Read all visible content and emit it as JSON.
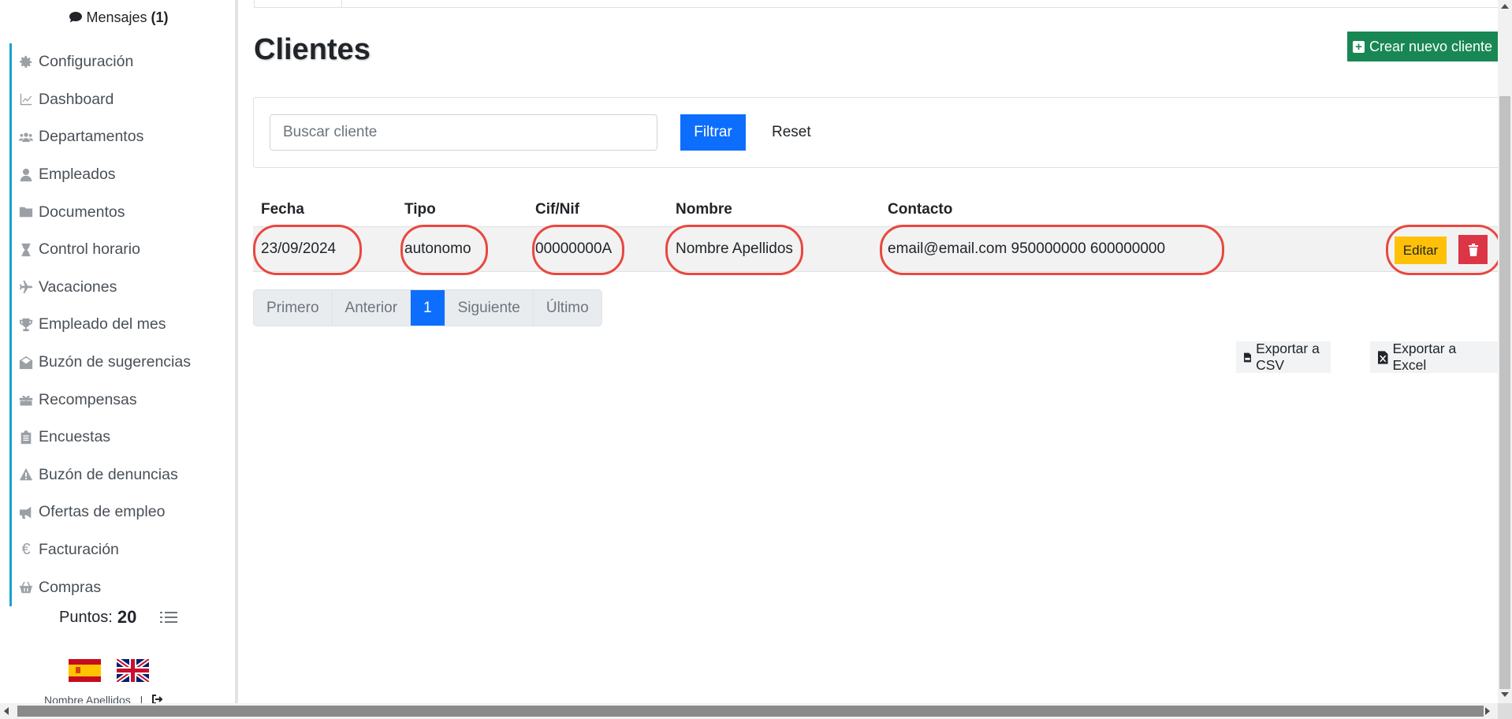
{
  "sidebar": {
    "messages_label": "Mensajes",
    "messages_count": "(1)",
    "items": [
      {
        "label": "Configuración",
        "icon": "gear-icon"
      },
      {
        "label": "Dashboard",
        "icon": "chart-line-icon"
      },
      {
        "label": "Departamentos",
        "icon": "users-icon"
      },
      {
        "label": "Empleados",
        "icon": "user-icon"
      },
      {
        "label": "Documentos",
        "icon": "folder-icon"
      },
      {
        "label": "Control horario",
        "icon": "hourglass-icon"
      },
      {
        "label": "Vacaciones",
        "icon": "plane-icon"
      },
      {
        "label": "Empleado del mes",
        "icon": "trophy-icon"
      },
      {
        "label": "Buzón de sugerencias",
        "icon": "envelope-open-icon"
      },
      {
        "label": "Recompensas",
        "icon": "gift-icon"
      },
      {
        "label": "Encuestas",
        "icon": "clipboard-icon"
      },
      {
        "label": "Buzón de denuncias",
        "icon": "warning-icon"
      },
      {
        "label": "Ofertas de empleo",
        "icon": "megaphone-icon"
      },
      {
        "label": "Facturación",
        "icon": "euro-icon"
      },
      {
        "label": "Compras",
        "icon": "basket-icon"
      }
    ],
    "points_label": "Puntos:",
    "points_value": "20",
    "user_name": "Nombre Apellidos",
    "user_sep": "|"
  },
  "page": {
    "title": "Clientes",
    "create_button": "Crear nuevo cliente",
    "search_placeholder": "Buscar cliente",
    "filter_button": "Filtrar",
    "reset_link": "Reset"
  },
  "table": {
    "headers": [
      "Fecha",
      "Tipo",
      "Cif/Nif",
      "Nombre",
      "Contacto"
    ],
    "rows": [
      {
        "fecha": "23/09/2024",
        "tipo": "autonomo",
        "cif": "00000000A",
        "nombre": "Nombre Apellidos",
        "contacto": "email@email.com 950000000 600000000",
        "edit_label": "Editar"
      }
    ]
  },
  "pagination": [
    "Primero",
    "Anterior",
    "1",
    "Siguiente",
    "Último"
  ],
  "export": {
    "csv": "Exportar a CSV",
    "excel": "Exportar a Excel"
  },
  "colors": {
    "primary": "#0d6efd",
    "success": "#198754",
    "warning": "#ffc107",
    "danger": "#dc3545",
    "highlight": "#e8483f",
    "sidebar_accent": "#17a2c8"
  }
}
